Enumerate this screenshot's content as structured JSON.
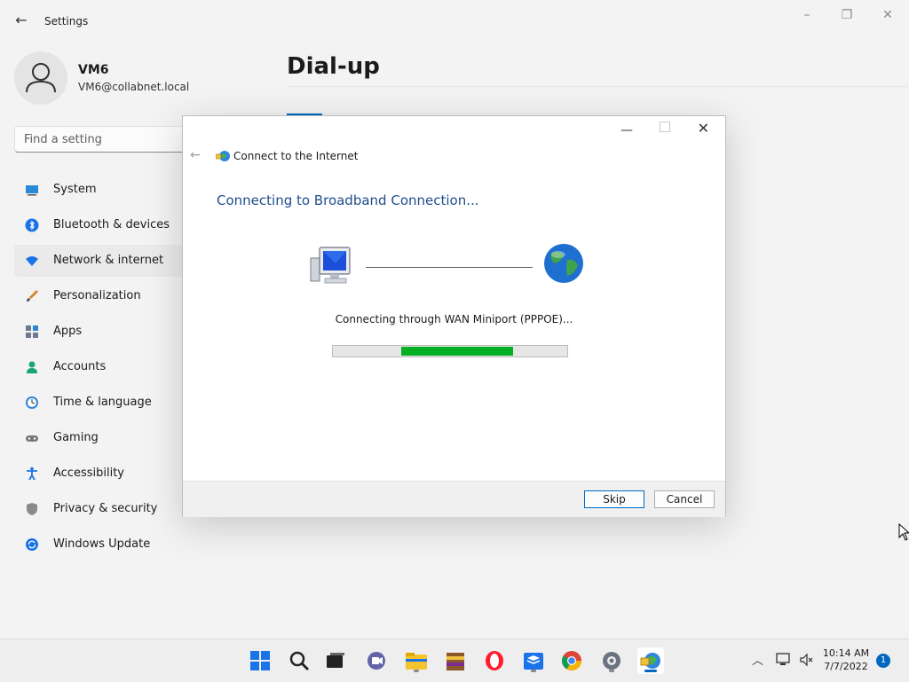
{
  "app": {
    "title": "Settings"
  },
  "user": {
    "name": "VM6",
    "email": "VM6@collabnet.local"
  },
  "search": {
    "placeholder": "Find a setting"
  },
  "nav": [
    {
      "label": "System",
      "icon": "system-icon",
      "selected": false
    },
    {
      "label": "Bluetooth & devices",
      "icon": "bluetooth-icon",
      "selected": false
    },
    {
      "label": "Network & internet",
      "icon": "wifi-icon",
      "selected": true
    },
    {
      "label": "Personalization",
      "icon": "brush-icon",
      "selected": false
    },
    {
      "label": "Apps",
      "icon": "apps-icon",
      "selected": false
    },
    {
      "label": "Accounts",
      "icon": "accounts-icon",
      "selected": false
    },
    {
      "label": "Time & language",
      "icon": "time-icon",
      "selected": false
    },
    {
      "label": "Gaming",
      "icon": "gaming-icon",
      "selected": false
    },
    {
      "label": "Accessibility",
      "icon": "accessibility-icon",
      "selected": false
    },
    {
      "label": "Privacy & security",
      "icon": "shield-icon",
      "selected": false
    },
    {
      "label": "Windows Update",
      "icon": "update-icon",
      "selected": false
    }
  ],
  "page": {
    "title": "Dial-up"
  },
  "dialog": {
    "title": "Connect to the Internet",
    "heading": "Connecting to Broadband Connection...",
    "status": "Connecting through WAN Miniport (PPPOE)...",
    "progress": {
      "start_fraction": 0.29,
      "end_fraction": 0.77
    },
    "buttons": {
      "skip": "Skip",
      "cancel": "Cancel"
    }
  },
  "taskbar": {
    "apps": [
      "start-icon",
      "search-icon",
      "task-view-icon",
      "chat-icon",
      "file-explorer-icon",
      "archive-icon",
      "opera-icon",
      "store-icon",
      "chrome-icon",
      "settings-icon",
      "network-globe-icon"
    ],
    "running": [
      "file-explorer-icon",
      "store-icon",
      "settings-icon",
      "network-globe-icon"
    ],
    "active": "network-globe-icon",
    "time": "10:14 AM",
    "date": "7/7/2022",
    "notifications": "1"
  },
  "colors": {
    "accent": "#0067c0",
    "progress": "#06b025",
    "heading": "#1e4e8c"
  }
}
